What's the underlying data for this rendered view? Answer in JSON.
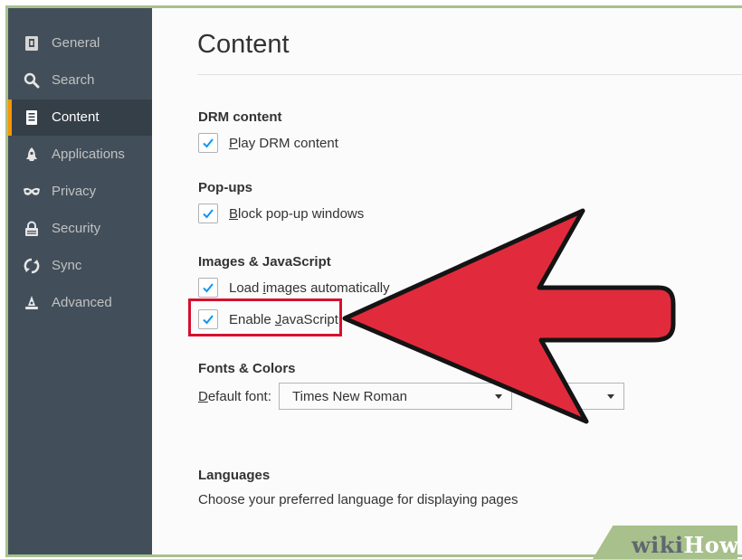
{
  "sidebar": {
    "items": [
      {
        "label": "General",
        "icon": "general-icon",
        "selected": false
      },
      {
        "label": "Search",
        "icon": "search-icon",
        "selected": false
      },
      {
        "label": "Content",
        "icon": "content-icon",
        "selected": true
      },
      {
        "label": "Applications",
        "icon": "applications-icon",
        "selected": false
      },
      {
        "label": "Privacy",
        "icon": "privacy-mask-icon",
        "selected": false
      },
      {
        "label": "Security",
        "icon": "security-lock-icon",
        "selected": false
      },
      {
        "label": "Sync",
        "icon": "sync-icon",
        "selected": false
      },
      {
        "label": "Advanced",
        "icon": "advanced-wizard-icon",
        "selected": false
      }
    ]
  },
  "page": {
    "title": "Content"
  },
  "drm": {
    "heading": "DRM content",
    "play": {
      "access_key": "P",
      "rest": "lay DRM content",
      "checked": true
    }
  },
  "popups": {
    "heading": "Pop-ups",
    "block": {
      "access_key": "B",
      "rest": "lock pop-up windows",
      "checked": true
    }
  },
  "images_js": {
    "heading": "Images & JavaScript",
    "load_images": {
      "pre": "Load ",
      "access_key": "i",
      "rest": "mages automatically",
      "checked": true
    },
    "enable_js": {
      "pre": "Enable ",
      "access_key": "J",
      "rest": "avaScript",
      "checked": true
    }
  },
  "fonts": {
    "heading": "Fonts & Colors",
    "default_font": {
      "access_key": "D",
      "rest": "efault font:",
      "value": "Times New Roman"
    }
  },
  "languages": {
    "heading": "Languages",
    "description": "Choose your preferred language for displaying pages"
  },
  "watermark": {
    "part1": "wiki",
    "part2": "How"
  },
  "colors": {
    "sidebar_bg": "#424f5a",
    "sidebar_selected": "#343f48",
    "selected_accent": "#ff9500",
    "checkbox_check": "#0996f8",
    "arrow_red": "#e12b3c",
    "highlight_box": "#d5112f",
    "frame_green": "#a8c08c"
  }
}
